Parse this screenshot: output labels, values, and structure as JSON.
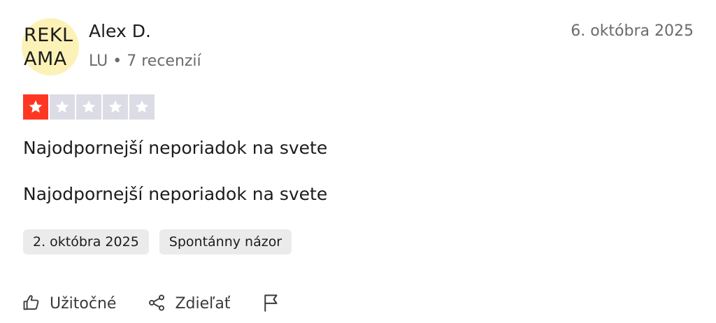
{
  "reviewer": {
    "avatar_text": "REKL\nAMA",
    "name": "Alex D.",
    "meta": "LU • 7 recenzií"
  },
  "review": {
    "date": "6. októbra 2025",
    "rating": 1,
    "max_rating": 5,
    "title": "Najodpornejší neporiadok na svete",
    "body": "Najodpornejší neporiadok na svete",
    "tags": {
      "experience_date": "2. októbra 2025",
      "source": "Spontánny názor"
    }
  },
  "actions": {
    "useful_label": "Užitočné",
    "share_label": "Zdieľať"
  },
  "colors": {
    "star_filled": "#ff3722",
    "star_empty": "#dcdce6",
    "avatar_bg": "#fcf2b8",
    "tag_bg": "#ebebeb"
  },
  "icons": {
    "star": "star-icon",
    "useful": "thumbs-up-icon",
    "share": "share-icon",
    "report": "flag-icon"
  }
}
